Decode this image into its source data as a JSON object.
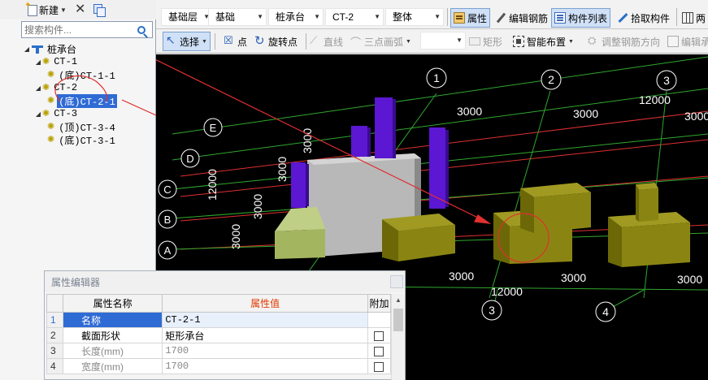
{
  "left_toolbar": {
    "new_label": "新建",
    "new_icon": "new-component-icon",
    "delete_icon": "delete-x-icon",
    "copy_icon": "copy-icon"
  },
  "search": {
    "placeholder": "搜索构件..."
  },
  "tree": {
    "root": "桩承台",
    "nodes": [
      {
        "label": "CT-1",
        "children": [
          "(底)CT-1-1"
        ]
      },
      {
        "label": "CT-2",
        "children": [
          "(底)CT-2-1"
        ]
      },
      {
        "label": "CT-3",
        "children": [
          "(顶)CT-3-4",
          "(底)CT-3-1"
        ]
      }
    ],
    "selected": "(底)CT-2-1"
  },
  "toolbar1": {
    "floor": "基础层",
    "category": "基础",
    "type": "桩承台",
    "component": "CT-2",
    "mode": "整体",
    "buttons": {
      "property": "属性",
      "edit_rebar": "编辑钢筋",
      "component_list": "构件列表",
      "pick": "拾取构件",
      "grid": "两"
    }
  },
  "toolbar2": {
    "select": "选择",
    "point": "点",
    "rotate_point": "旋转点",
    "line": "直线",
    "arc": "三点画弧",
    "rect": "矩形",
    "smart": "智能布置",
    "adjust_rebar": "调整钢筋方向",
    "edit2": "编辑承"
  },
  "viewport": {
    "column_axes": [
      "1",
      "2",
      "3",
      "3",
      "4"
    ],
    "row_axes": [
      "E",
      "D",
      "C",
      "B",
      "A"
    ],
    "dims": [
      "3000",
      "3000",
      "12000",
      "3000",
      "3000",
      "3000",
      "12000",
      "3000",
      "3000",
      "3000",
      "12000",
      "3000",
      "3000"
    ],
    "colors": {
      "background": "#000000",
      "grid_green": "#2fa82f",
      "grid_red": "#e03030",
      "pile": "#5b17d1",
      "cap_olive": "#7f7a10",
      "cap_gray": "#b4b4b4",
      "cap_light": "#a8ba6a",
      "annotation": "#e03030"
    }
  },
  "prop_editor": {
    "title": "属性编辑器",
    "headers": {
      "name": "属性名称",
      "value": "属性值",
      "extra": "附加"
    },
    "rows": [
      {
        "index": "1",
        "name": "名称",
        "value": "CT-2-1",
        "checkbox": false
      },
      {
        "index": "2",
        "name": "截面形状",
        "value": "矩形承台",
        "checkbox": true
      },
      {
        "index": "3",
        "name": "长度(mm)",
        "value": "1700",
        "checkbox": true
      },
      {
        "index": "4",
        "name": "宽度(mm)",
        "value": "1700",
        "checkbox": true
      }
    ]
  }
}
